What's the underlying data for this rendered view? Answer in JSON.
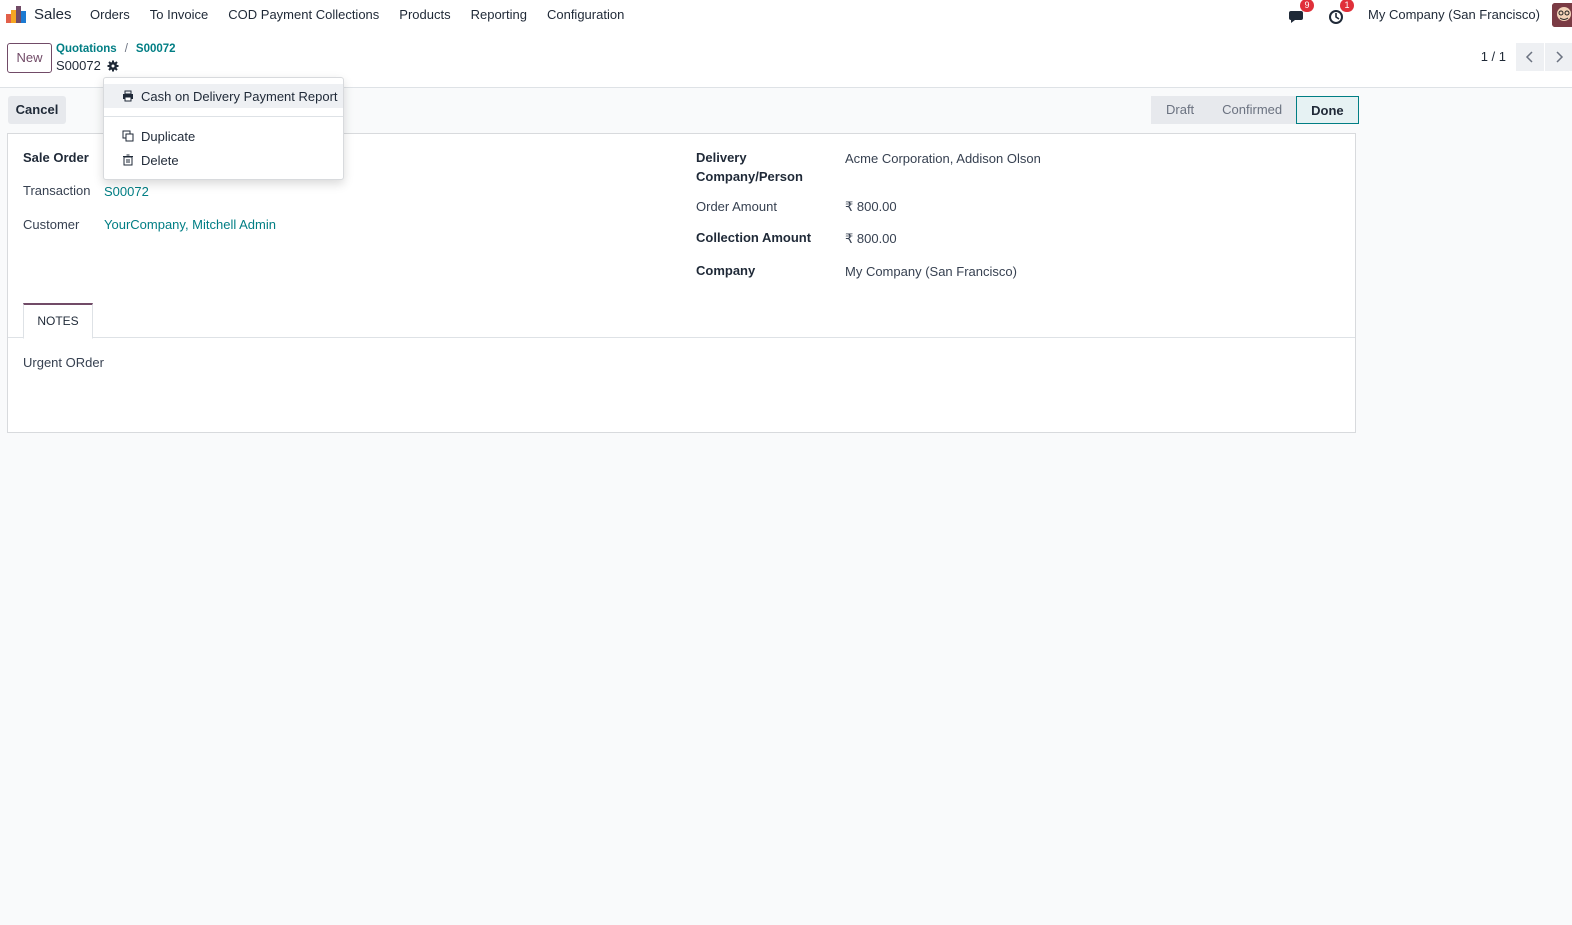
{
  "navbar": {
    "app_name": "Sales",
    "menu": [
      "Orders",
      "To Invoice",
      "COD Payment Collections",
      "Products",
      "Reporting",
      "Configuration"
    ],
    "messages_badge": "9",
    "activities_badge": "1",
    "company": "My Company (San Francisco)"
  },
  "control_panel": {
    "new_label": "New",
    "breadcrumb": [
      "Quotations",
      "S00072"
    ],
    "breadcrumb_sep": "/",
    "record_title": "S00072",
    "pager": "1 / 1"
  },
  "actions": {
    "cancel_label": "Cancel",
    "stages": [
      "Draft",
      "Confirmed",
      "Done"
    ],
    "active_stage": "Done"
  },
  "dropdown": {
    "print_item": "Cash on Delivery Payment Report",
    "duplicate_item": "Duplicate",
    "delete_item": "Delete"
  },
  "form": {
    "left": {
      "sale_order_label": "Sale Order",
      "transaction_label": "Transaction",
      "transaction_value": "S00072",
      "customer_label": "Customer",
      "customer_value": "YourCompany, Mitchell Admin"
    },
    "right": {
      "delivery_label_line1": "Delivery",
      "delivery_label_line2": "Company/Person",
      "delivery_value": "Acme Corporation, Addison Olson",
      "order_amount_label": "Order Amount",
      "order_amount_value": "₹ 800.00",
      "collection_amount_label": "Collection Amount",
      "collection_amount_value": "₹ 800.00",
      "company_label": "Company",
      "company_value": "My Company (San Francisco)"
    },
    "tab_label": "NOTES",
    "notes": "Urgent ORder"
  },
  "colors": {
    "brand": "#714b67",
    "link": "#017e84",
    "badge": "#e0303a"
  }
}
